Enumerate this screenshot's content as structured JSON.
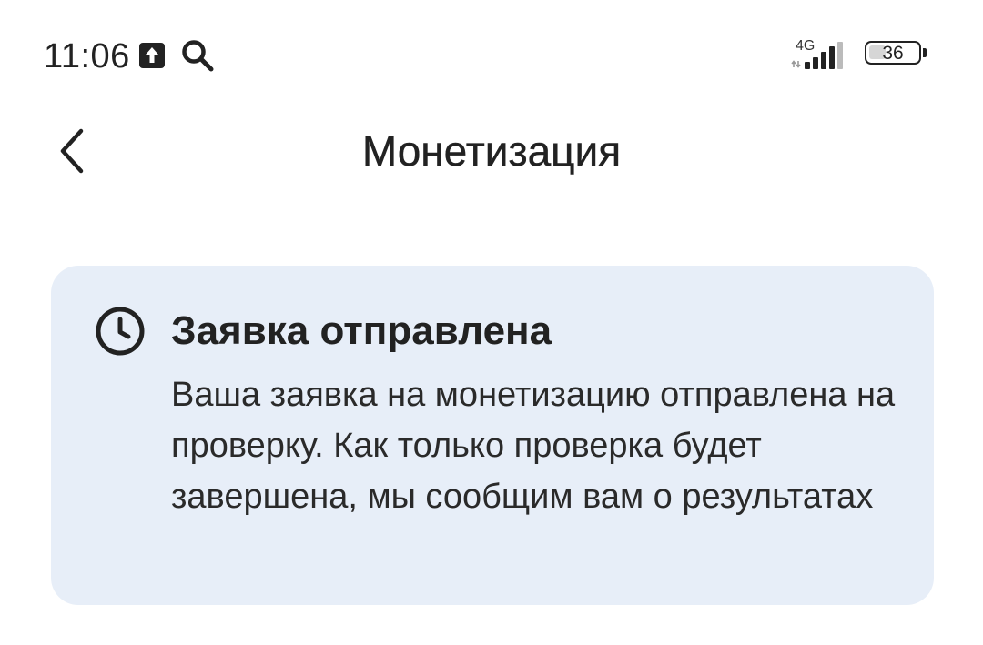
{
  "status_bar": {
    "time": "11:06",
    "network": "4G",
    "battery": "36",
    "battery_level": 0.36,
    "icons": [
      "upload-icon",
      "search-icon",
      "signal-icon",
      "battery-icon"
    ]
  },
  "header": {
    "title": "Монетизация",
    "back_icon": "chevron-left-icon"
  },
  "card": {
    "icon": "clock-icon",
    "title": "Заявка отправлена",
    "text": "Ваша заявка на монетизацию отправлена на проверку. Как только проверка будет завершена, мы сообщим вам о результатах"
  },
  "colors": {
    "card_background": "#e7eef8",
    "text": "#222222",
    "background": "#ffffff"
  }
}
